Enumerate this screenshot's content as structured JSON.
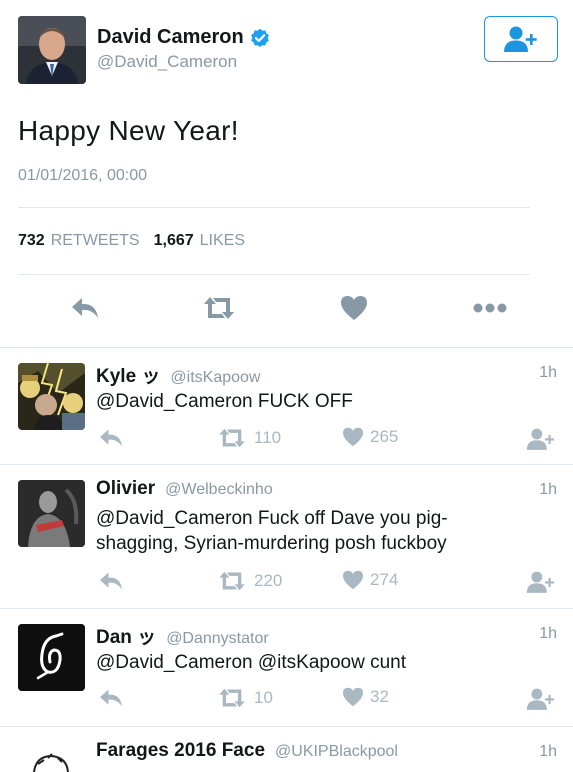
{
  "tweet": {
    "author_name": "David Cameron",
    "author_handle": "@David_Cameron",
    "text": "Happy New Year!",
    "timestamp": "01/01/2016, 00:00",
    "retweets_count": "732",
    "retweets_label": "RETWEETS",
    "likes_count": "1,667",
    "likes_label": "LIKES"
  },
  "replies": [
    {
      "name": "Kyle ッ",
      "handle": "@itsKapoow",
      "time": "1h",
      "text": "@David_Cameron FUCK OFF",
      "retweets": "110",
      "likes": "265"
    },
    {
      "name": "Olivier",
      "handle": "@Welbeckinho",
      "time": "1h",
      "text": "@David_Cameron Fuck off Dave you pig-shagging, Syrian-murdering posh fuckboy",
      "retweets": "220",
      "likes": "274"
    },
    {
      "name": "Dan ッ",
      "handle": "@Dannystator",
      "time": "1h",
      "text": "@David_Cameron @itsKapoow cunt",
      "retweets": "10",
      "likes": "32"
    },
    {
      "name": "Farages 2016 Face",
      "handle": "@UKIPBlackpool",
      "time": "1h",
      "text": ""
    }
  ],
  "colors": {
    "accent": "#1b95e0",
    "icon_gray": "#aab8c2",
    "text_gray": "#8899a6"
  }
}
